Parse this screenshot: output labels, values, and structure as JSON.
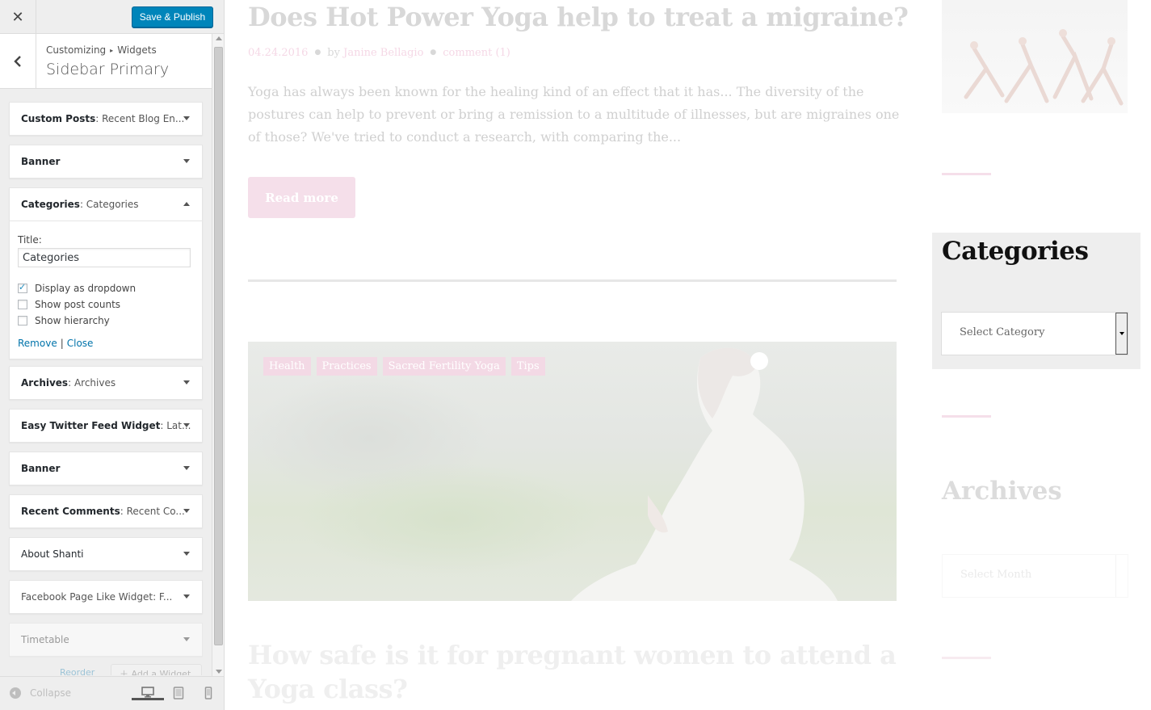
{
  "customizer": {
    "close_icon": "close-icon",
    "publish_label": "Save & Publish",
    "breadcrumb": {
      "root": "Customizing",
      "current": "Widgets"
    },
    "section_title": "Sidebar Primary",
    "widgets": [
      {
        "name": "Custom Posts",
        "sub": "Recent Blog En..."
      },
      {
        "name": "Banner",
        "sub": ""
      },
      {
        "name": "Categories",
        "sub": "Categories"
      },
      {
        "name": "Archives",
        "sub": "Archives"
      },
      {
        "name": "Easy Twitter Feed Widget",
        "sub": "Lat..."
      },
      {
        "name": "Banner",
        "sub": ""
      },
      {
        "name": "Recent Comments",
        "sub": "Recent Co..."
      },
      {
        "name": "About Shanti",
        "sub": ""
      },
      {
        "name": "Facebook Page Like Widget",
        "sub": "F..."
      },
      {
        "name": "Timetable",
        "sub": ""
      }
    ],
    "categories_form": {
      "title_label": "Title:",
      "title_value": "Categories",
      "options": [
        {
          "label": "Display as dropdown",
          "checked": true
        },
        {
          "label": "Show post counts",
          "checked": false
        },
        {
          "label": "Show hierarchy",
          "checked": false
        }
      ],
      "remove_label": "Remove",
      "separator": "|",
      "close_label": "Close"
    },
    "reorder_label": "Reorder",
    "add_widget_label": "Add a Widget",
    "collapse_label": "Collapse"
  },
  "preview": {
    "post1": {
      "title": "Does Hot Power Yoga help to treat a migraine?",
      "date": "04.24.2016",
      "by": "by",
      "author": "Janine Bellagio",
      "comments": "comment (1)",
      "excerpt": "Yoga has always been known for the healing kind of an effect that it has... The diversity of the postures can help to prevent or bring a remission to a multitude of illnesses, but are migraines one of those? We've tried to conduct a research, with comparing the...",
      "read_more": "Read more"
    },
    "post2": {
      "tags": [
        "Health",
        "Practices",
        "Sacred Fertility Yoga",
        "Tips"
      ],
      "title": "How safe is it for pregnant women to attend a Yoga class?"
    },
    "sidebar": {
      "categories_title": "Categories",
      "categories_select": "Select Category",
      "archives_title": "Archives",
      "archives_select": "Select Month"
    }
  },
  "colors": {
    "accent_blue": "#0085ba",
    "link_blue": "#0073aa",
    "accent_pink": "#f5dfea"
  }
}
